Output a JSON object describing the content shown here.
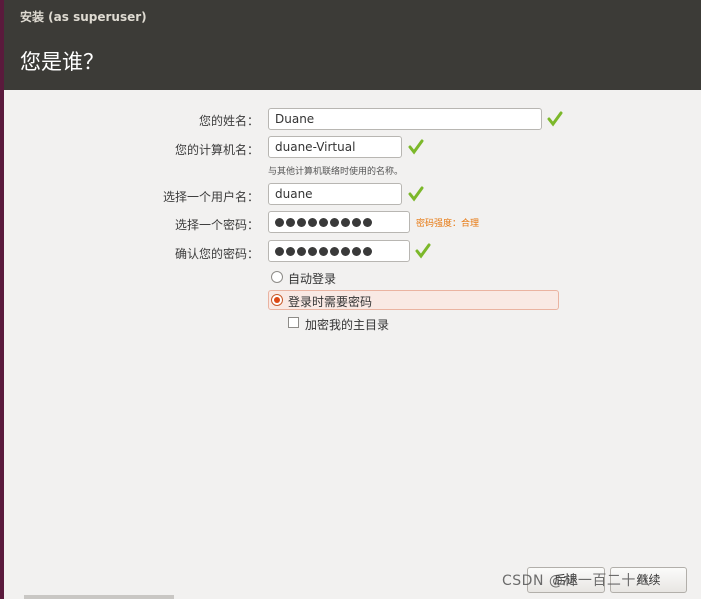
{
  "window": {
    "title": "安装 (as superuser)",
    "heading": "您是谁？"
  },
  "form": {
    "name_label": "您的姓名：",
    "name_value": "Duane",
    "computer_label": "您的计算机名：",
    "computer_value": "duane-Virtual",
    "computer_hint": "与其他计算机联络时使用的名称。",
    "username_label": "选择一个用户名：",
    "username_value": "duane",
    "password_label": "选择一个密码：",
    "password_strength": "密码强度：合理",
    "confirm_label": "确认您的密码：",
    "password_mask_length": 9
  },
  "login_options": {
    "auto_login": "自动登录",
    "require_password": "登录时需要密码",
    "require_password_selected": true,
    "encrypt_home": "加密我的主目录",
    "encrypt_home_checked": false
  },
  "buttons": {
    "back": "后退",
    "continue": "继续"
  },
  "watermark": "CSDN @林一百二十八",
  "colors": {
    "titlebar": "#3c3b37",
    "accent": "#dd4814",
    "check": "#7cb82a",
    "strength": "#e7770e"
  }
}
